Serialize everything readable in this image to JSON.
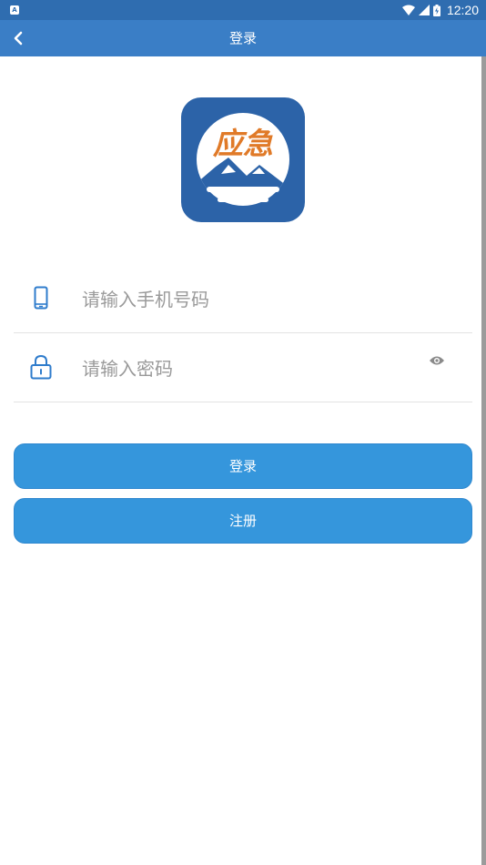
{
  "status_bar": {
    "time": "12:20",
    "notification_icon": "a-notification-icon"
  },
  "app_bar": {
    "title": "登录",
    "back_icon": "chevron-left-icon"
  },
  "logo": {
    "text": "应急",
    "brand_color": "#2c63a8",
    "accent_color": "#e07a28"
  },
  "form": {
    "phone": {
      "placeholder": "请输入手机号码",
      "value": "",
      "icon": "phone-icon"
    },
    "password": {
      "placeholder": "请输入密码",
      "value": "",
      "icon": "lock-icon",
      "toggle_icon": "eye-icon"
    }
  },
  "buttons": {
    "login_label": "登录",
    "register_label": "注册",
    "color": "#3596dc"
  }
}
